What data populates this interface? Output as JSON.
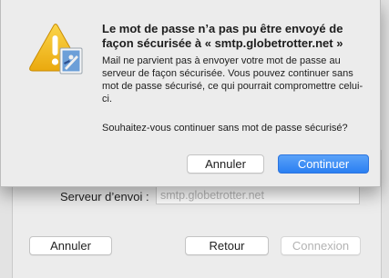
{
  "background": {
    "server_label": "Serveur d’envoi :",
    "server_value": "smtp.globetrotter.net",
    "cancel_label": "Annuler",
    "back_label": "Retour",
    "connect_label": "Connexion"
  },
  "alert": {
    "title": "Le mot de passe n’a pas pu être envoyé de façon sécurisée à « smtp.globetrotter.net »",
    "message": "Mail ne parvient pas à envoyer votre mot de passe au serveur de façon sécurisée. Vous pouvez continuer sans mot de passe sécurisé, ce qui pourrait compromettre celui-ci.",
    "question": "Souhaitez-vous continuer sans mot de passe sécurisé?",
    "cancel_label": "Annuler",
    "continue_label": "Continuer",
    "icon": "warning-icon",
    "badge_icon": "mail-stamp-icon"
  },
  "colors": {
    "accent": "#2a7ff2",
    "warning": "#f4c21b"
  }
}
